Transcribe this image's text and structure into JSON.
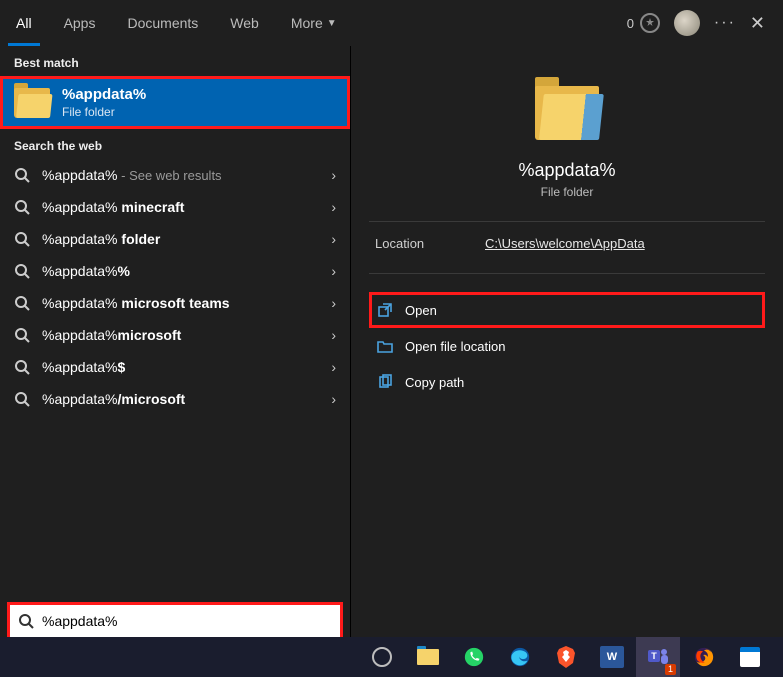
{
  "header": {
    "tabs": [
      {
        "label": "All",
        "active": true
      },
      {
        "label": "Apps",
        "active": false
      },
      {
        "label": "Documents",
        "active": false
      },
      {
        "label": "Web",
        "active": false
      },
      {
        "label": "More",
        "active": false,
        "dropdown": true
      }
    ],
    "points": "0"
  },
  "sections": {
    "best_match": "Best match",
    "search_web": "Search the web"
  },
  "best_match": {
    "title": "%appdata%",
    "subtitle": "File folder"
  },
  "web_results": [
    {
      "prefix": "%appdata%",
      "bold": "",
      "sub": " - See web results"
    },
    {
      "prefix": "%appdata% ",
      "bold": "minecraft",
      "sub": ""
    },
    {
      "prefix": "%appdata% ",
      "bold": "folder",
      "sub": ""
    },
    {
      "prefix": "%appdata%",
      "bold": "%",
      "sub": ""
    },
    {
      "prefix": "%appdata% ",
      "bold": "microsoft teams",
      "sub": ""
    },
    {
      "prefix": "%appdata%",
      "bold": "microsoft",
      "sub": ""
    },
    {
      "prefix": "%appdata%",
      "bold": "$",
      "sub": ""
    },
    {
      "prefix": "%appdata%",
      "bold": "/microsoft",
      "sub": ""
    }
  ],
  "preview": {
    "title": "%appdata%",
    "subtitle": "File folder",
    "location_label": "Location",
    "location_value": "C:\\Users\\welcome\\AppData",
    "actions": {
      "open": "Open",
      "open_loc": "Open file location",
      "copy_path": "Copy path"
    }
  },
  "search": {
    "value": "%appdata%"
  },
  "taskbar": {
    "teams_badge": "1"
  }
}
